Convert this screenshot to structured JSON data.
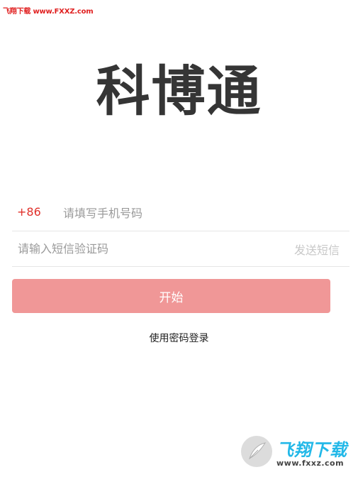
{
  "watermark": {
    "top_text": "飞翔下载 www.FXXZ.com",
    "brand_text": "飞翔下载",
    "url_text": "www.fxxz.com"
  },
  "app": {
    "title": "科博通"
  },
  "login": {
    "country_code": "+86",
    "phone_placeholder": "请填写手机号码",
    "code_placeholder": "请输入短信验证码",
    "send_sms_label": "发送短信",
    "start_button_label": "开始",
    "password_login_label": "使用密码登录"
  },
  "colors": {
    "accent_red": "#e0302a",
    "start_button_bg": "#f09797",
    "title_text": "#353535",
    "watermark_blue": "#22b8e8"
  },
  "icons": {
    "watermark_emblem": "feather-emblem-icon"
  }
}
